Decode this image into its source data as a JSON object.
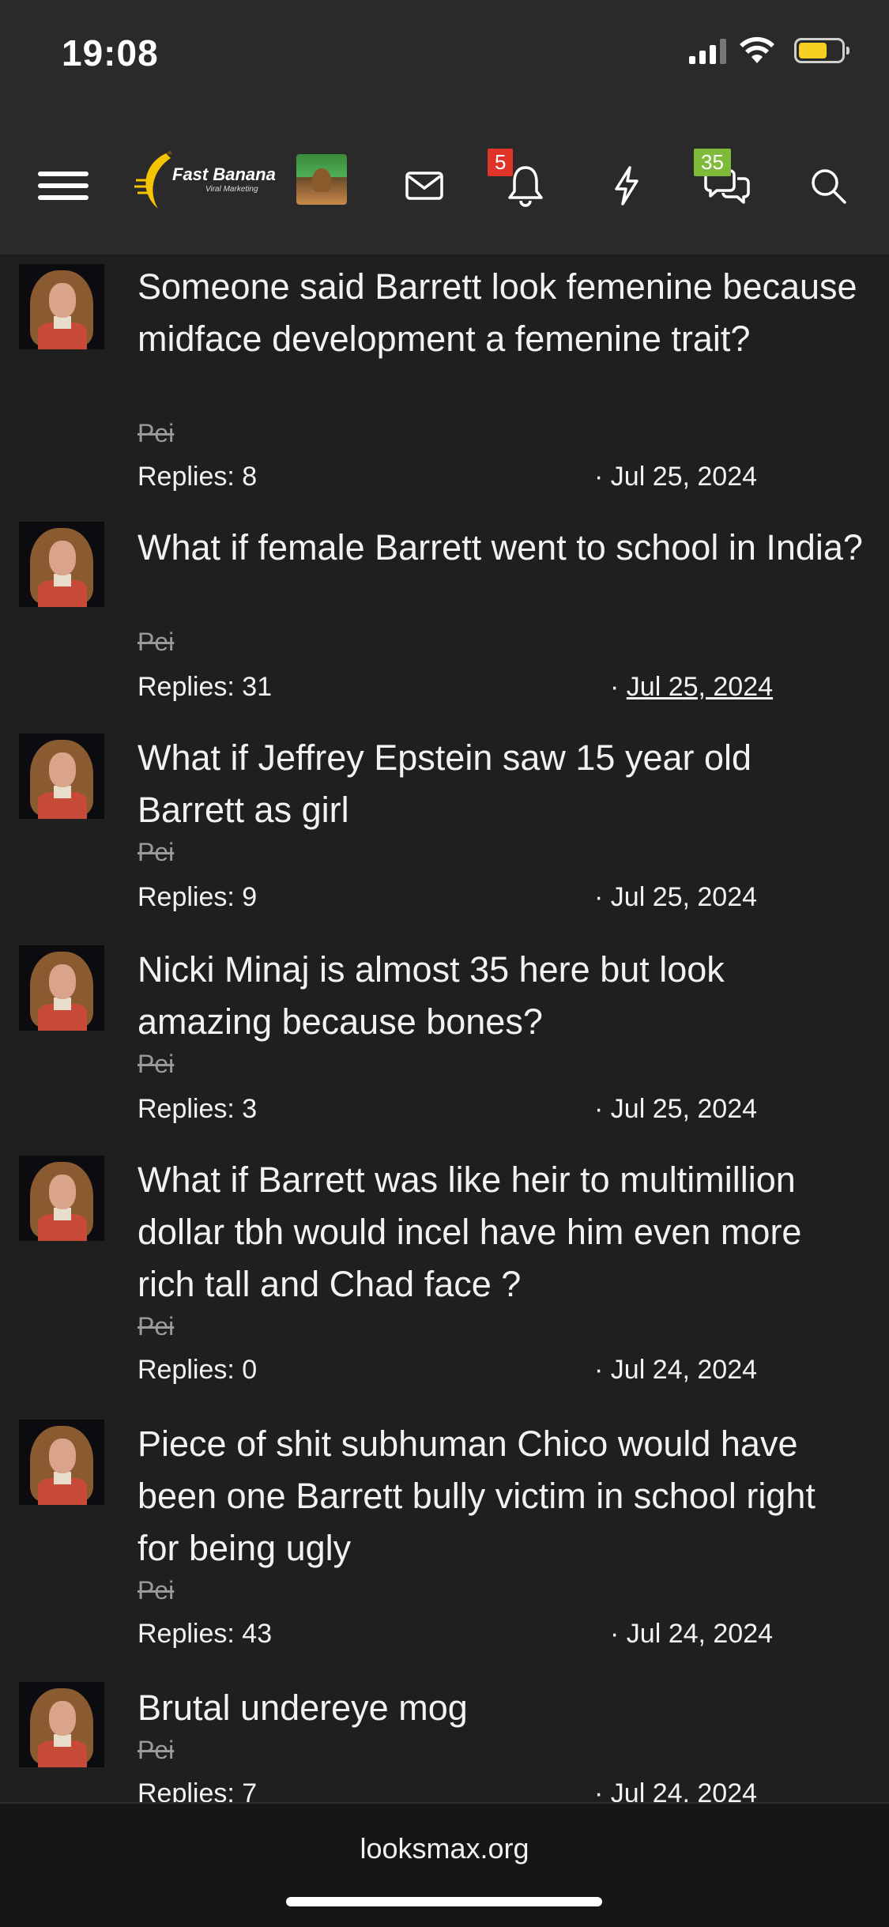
{
  "status_bar": {
    "time": "19:08",
    "battery_level": 0.6,
    "battery_color": "#f5d020"
  },
  "navbar": {
    "menu_icon": "hamburger-icon",
    "logo": {
      "text": "Fast Banana",
      "subtext": "Viral Marketing"
    },
    "game_thumbnail_icon": "game-thumbnail",
    "mail_icon": "envelope-icon",
    "alerts": {
      "icon": "bell-icon",
      "badge": "5",
      "badge_color": "#e0342b"
    },
    "whats_new_icon": "lightning-icon",
    "conversations": {
      "icon": "chat-bubbles-icon",
      "badge": "35",
      "badge_color": "#7fba3a"
    },
    "search_icon": "search-icon"
  },
  "threads": [
    {
      "title": "Someone said Barrett look femenine because midface development a femenine trait?",
      "author": "Pei",
      "replies": "Replies: 8",
      "date": "Jul 25, 2024"
    },
    {
      "title": "What if female Barrett went to school in India?",
      "author": "Pei",
      "replies": "Replies: 31",
      "date": "Jul 25, 2024"
    },
    {
      "title": "What if Jeffrey Epstein saw 15 year old Barrett as girl",
      "author": "Pei",
      "replies": "Replies: 9",
      "date": "Jul 25, 2024"
    },
    {
      "title": "Nicki Minaj is almost 35 here but look amazing because bones?",
      "author": "Pei",
      "replies": "Replies: 3",
      "date": "Jul 25, 2024"
    },
    {
      "title": "What if Barrett was like heir to multimillion dollar tbh would incel have him even more rich tall and Chad face ?",
      "author": "Pei",
      "replies": "Replies: 0",
      "date": "Jul 24, 2024"
    },
    {
      "title": "Piece of shit subhuman Chico would have been one Barrett bully victim in school right for being ugly",
      "author": "Pei",
      "replies": "Replies: 43",
      "date": "Jul 24, 2024"
    },
    {
      "title": "Brutal undereye mog",
      "author": "Pei",
      "replies": "Replies: 7",
      "date": "Jul 24, 2024"
    }
  ],
  "date_separator": "·",
  "browser": {
    "url": "looksmax.org"
  }
}
